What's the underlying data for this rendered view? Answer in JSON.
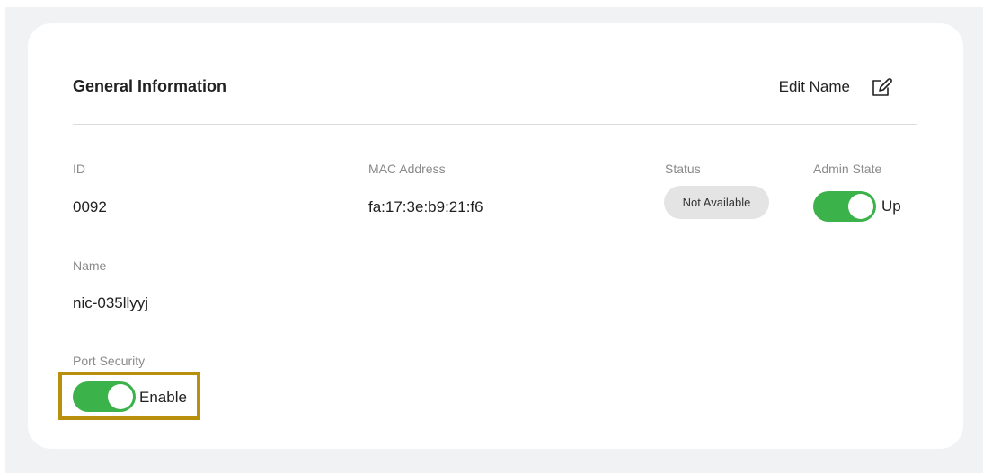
{
  "card": {
    "title": "General Information",
    "edit_name_label": "Edit Name",
    "edit_icon": "pencil-edit-icon"
  },
  "fields": {
    "id": {
      "label": "ID",
      "value": "0092"
    },
    "mac": {
      "label": "MAC Address",
      "value": "fa:17:3e:b9:21:f6"
    },
    "status": {
      "label": "Status",
      "value": "Not Available"
    },
    "admin_state": {
      "label": "Admin State",
      "value": "Up",
      "on": true
    },
    "name": {
      "label": "Name",
      "value": "nic-035llyyj"
    },
    "port_security": {
      "label": "Port Security",
      "value": "Enable",
      "on": true
    }
  },
  "colors": {
    "toggle_on": "#3bb34a",
    "highlight_border": "#b8900e",
    "badge_bg": "#e4e4e4"
  }
}
